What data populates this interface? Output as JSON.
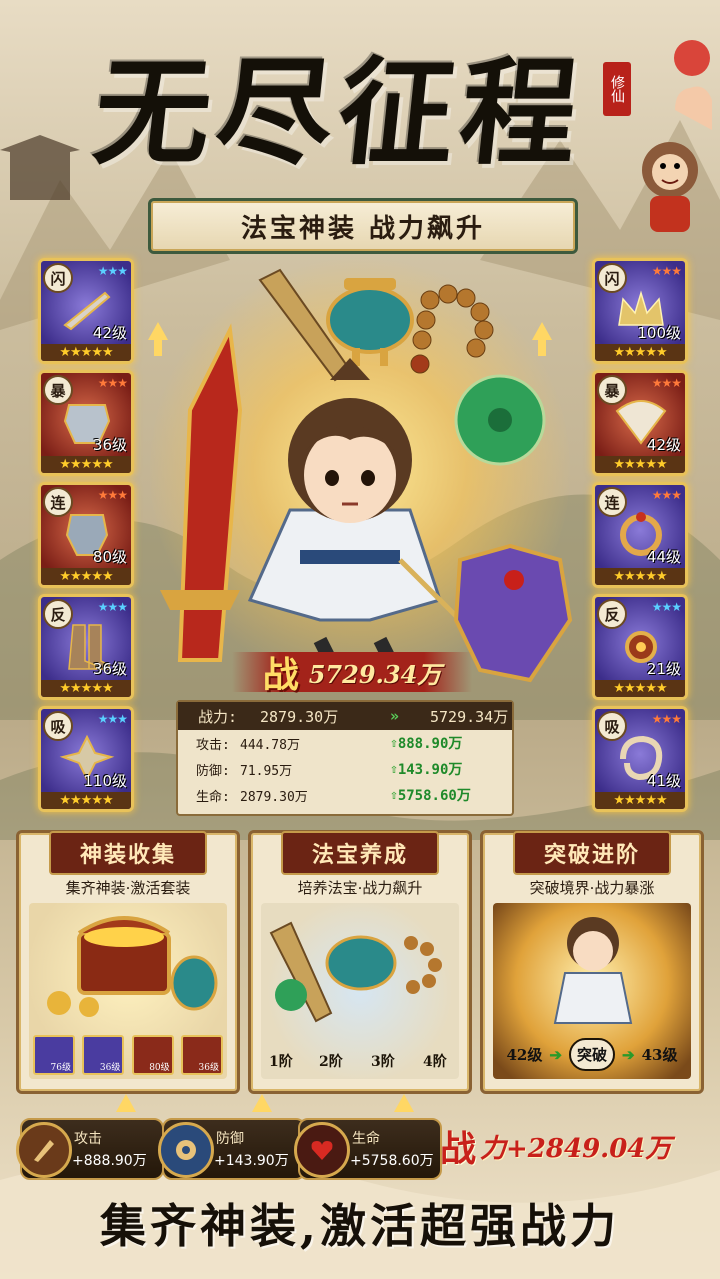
{
  "header": {
    "title": "无尽征程",
    "seal": "修仙",
    "banner": "法宝神装 战力飙升"
  },
  "left_cards": [
    {
      "tag": "闪",
      "level": "42级",
      "color": "purple"
    },
    {
      "tag": "暴",
      "level": "36级",
      "color": "red"
    },
    {
      "tag": "连",
      "level": "80级",
      "color": "red"
    },
    {
      "tag": "反",
      "level": "36级",
      "color": "purple"
    },
    {
      "tag": "吸",
      "level": "110级",
      "color": "purple"
    }
  ],
  "right_cards": [
    {
      "tag": "闪",
      "level": "100级",
      "color": "purple"
    },
    {
      "tag": "暴",
      "level": "42级",
      "color": "red"
    },
    {
      "tag": "连",
      "level": "44级",
      "color": "purple"
    },
    {
      "tag": "反",
      "level": "21级",
      "color": "purple"
    },
    {
      "tag": "吸",
      "level": "41级",
      "color": "purple"
    }
  ],
  "power": {
    "glyph": "战",
    "value": "5729.34万"
  },
  "stats": {
    "head_label": "战力:",
    "head_before": "2879.30万",
    "head_after": "5729.34万",
    "rows": [
      {
        "label": "攻击:",
        "before": "444.78万",
        "after": "888.90万"
      },
      {
        "label": "防御:",
        "before": "71.95万",
        "after": "143.90万"
      },
      {
        "label": "生命:",
        "before": "2879.30万",
        "after": "5758.60万"
      }
    ]
  },
  "panels": [
    {
      "title": "神装收集",
      "subtitle": "集齐神装·激活套装",
      "mini_levels": [
        "76级",
        "36级",
        "80级",
        "36级"
      ]
    },
    {
      "title": "法宝养成",
      "subtitle": "培养法宝·战力飙升",
      "steps": [
        "1阶",
        "2阶",
        "3阶",
        "4阶"
      ]
    },
    {
      "title": "突破进阶",
      "subtitle": "突破境界·战力暴涨",
      "from": "42级",
      "action": "突破",
      "to": "43级"
    }
  ],
  "bottom_stats": [
    {
      "label": "攻击",
      "value": "+888.90万",
      "icon": "sword-icon"
    },
    {
      "label": "防御",
      "value": "+143.90万",
      "icon": "shield-icon"
    },
    {
      "label": "生命",
      "value": "+5758.60万",
      "icon": "heart-icon"
    }
  ],
  "total_power": {
    "glyph": "战",
    "text": "力+2849.04万"
  },
  "slogan": "集齐神装,激活超强战力",
  "colors": {
    "accent_red": "#a3231a",
    "gold": "#e8c25a",
    "stat_green": "#1f8a2a"
  }
}
